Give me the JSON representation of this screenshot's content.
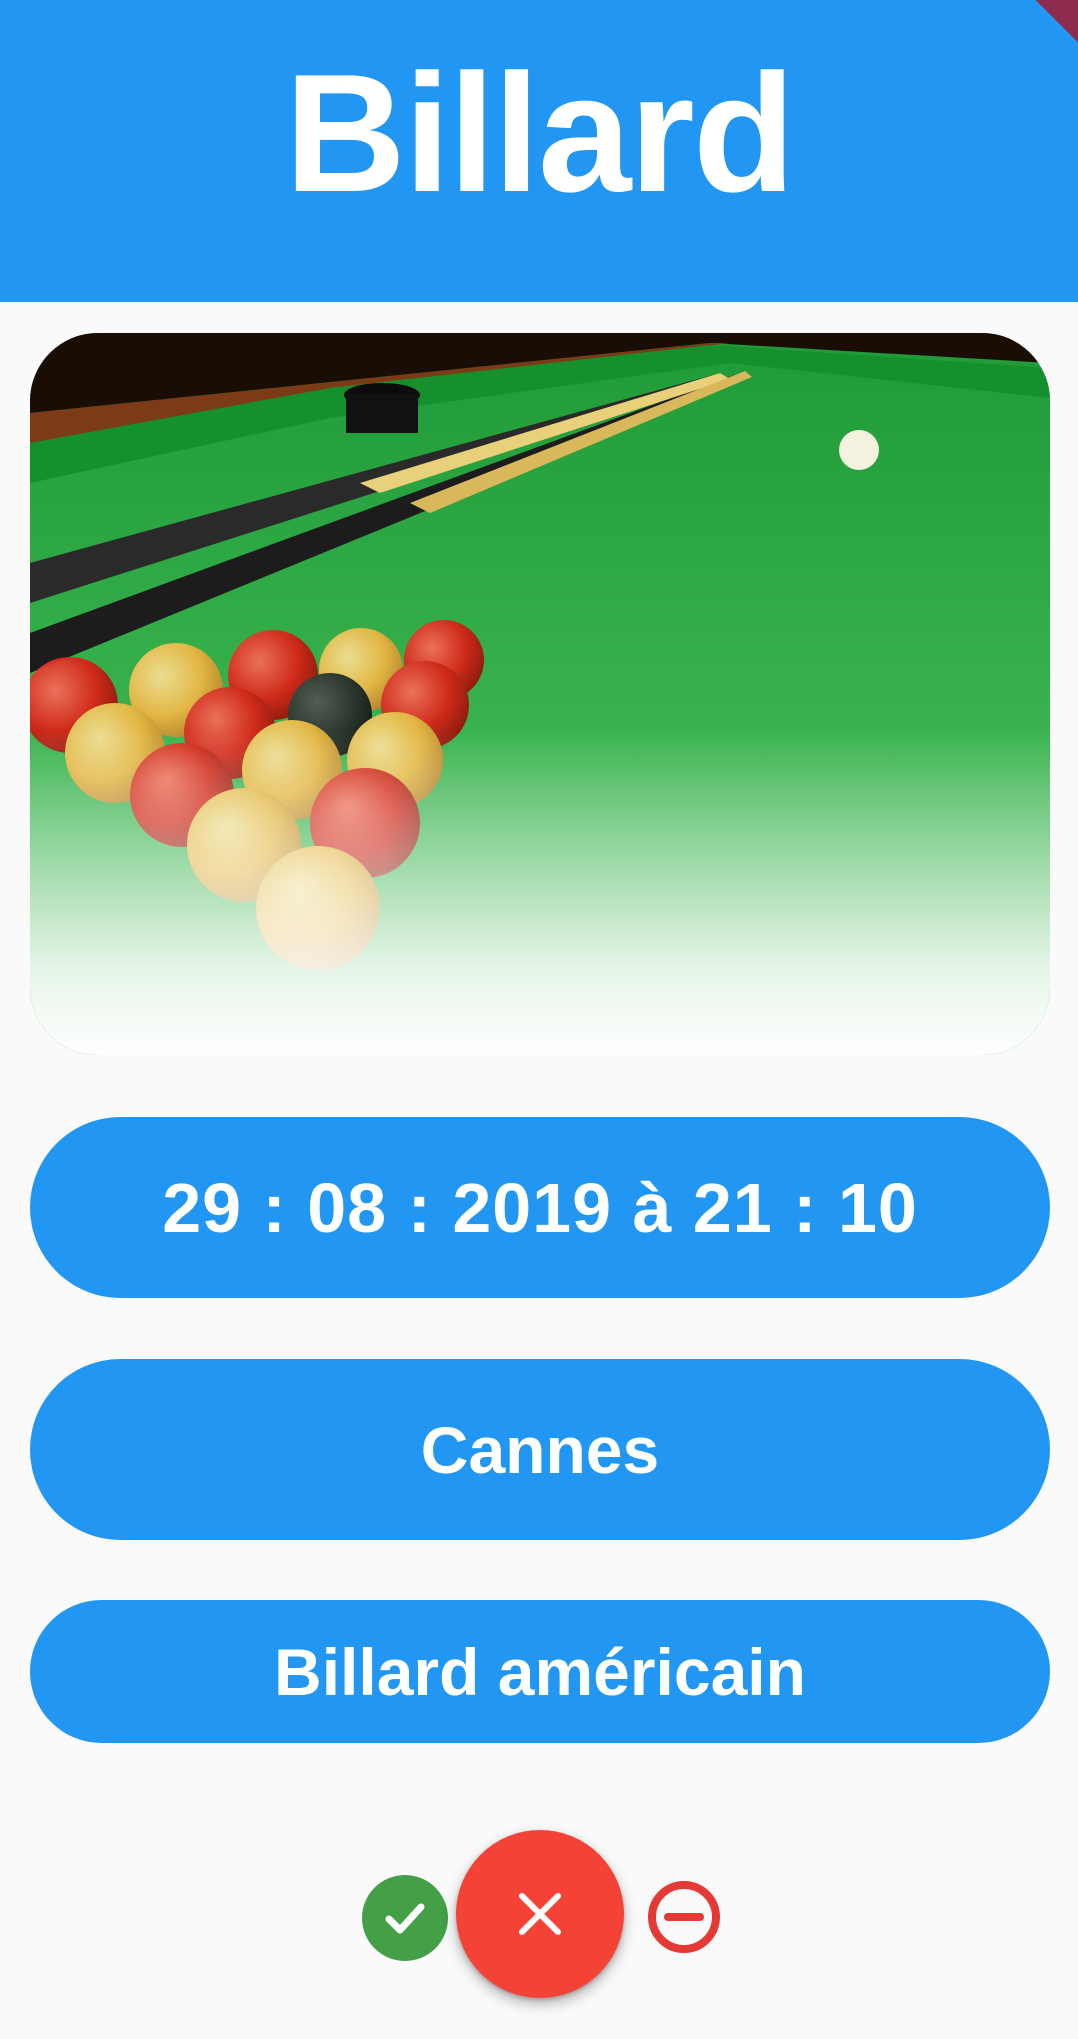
{
  "app_bar": {
    "title": "Billard",
    "background_color": "#2196F3"
  },
  "hero_image": {
    "subject": "pool-table-with-balls-and-cues"
  },
  "event": {
    "datetime": "29 : 08 : 2019 à 21 : 10",
    "city": "Cannes",
    "activity_type": "Billard américain"
  },
  "actions": {
    "accept_icon": "check-circle-icon",
    "reject_icon": "close-icon",
    "remove_icon": "minus-circle-icon",
    "accept_color": "#43A047",
    "reject_color": "#F44336",
    "remove_color": "#E53935"
  }
}
